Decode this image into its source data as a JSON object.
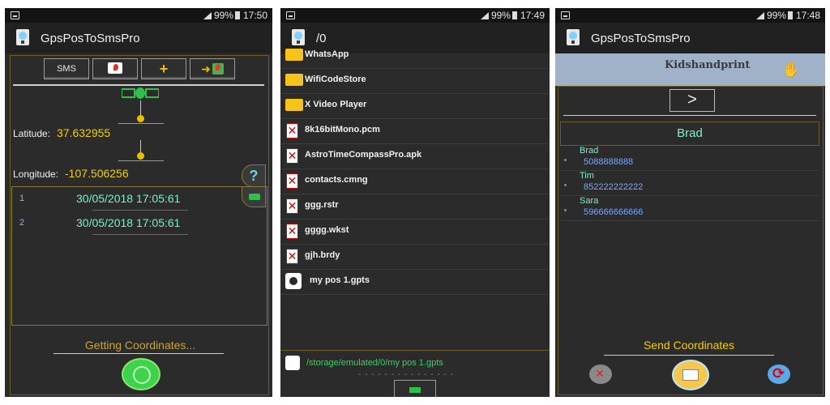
{
  "screen1": {
    "status": {
      "battery": "99%",
      "time": "17:50"
    },
    "app_title": "GpsPosToSmsPro",
    "toolbar": {
      "sms_label": "SMS",
      "add_label": "+"
    },
    "latitude_label": "Latitude:",
    "latitude_value": "37.632955",
    "longitude_label": "Longitude:",
    "longitude_value": "-107.506256",
    "help_label": "?",
    "history": [
      {
        "index": "1",
        "time": "30/05/2018 17:05:61"
      },
      {
        "index": "2",
        "time": "30/05/2018 17:05:61"
      }
    ],
    "status_text": "Getting Coordinates..."
  },
  "screen2": {
    "status": {
      "battery": "99%",
      "time": "17:49"
    },
    "path_title": "/0",
    "files": [
      {
        "name": "WhatsApp",
        "icon": "folder-icon"
      },
      {
        "name": "WifiCodeStore",
        "icon": "folder-icon"
      },
      {
        "name": "X Video Player",
        "icon": "folder-icon"
      },
      {
        "name": "8k16bitMono.pcm",
        "icon": "file-x-icon"
      },
      {
        "name": "AstroTimeCompassPro.apk",
        "icon": "file-x-icon"
      },
      {
        "name": "contacts.cmng",
        "icon": "file-x-icon"
      },
      {
        "name": "ggg.rstr",
        "icon": "file-x-icon"
      },
      {
        "name": "gggg.wkst",
        "icon": "file-x-icon"
      },
      {
        "name": "gjh.brdy",
        "icon": "file-x-icon"
      },
      {
        "name": "my pos 1.gpts",
        "icon": "gpts-file-icon"
      }
    ],
    "selected_path": "/storage/emulated/0/my pos 1.gpts",
    "dashes": "- - - - - - - - - - - - - - -"
  },
  "screen3": {
    "status": {
      "battery": "99%",
      "time": "17:48"
    },
    "app_title": "GpsPosToSmsPro",
    "banner_text": "Kidshandprint",
    "next_label": ">",
    "selected_name": "Brad",
    "contacts": [
      {
        "name": "Brad",
        "number": "5088888888"
      },
      {
        "name": "Tim",
        "number": "852222222222"
      },
      {
        "name": "Sara",
        "number": "596666666666"
      }
    ],
    "send_label": "Send Coordinates"
  }
}
